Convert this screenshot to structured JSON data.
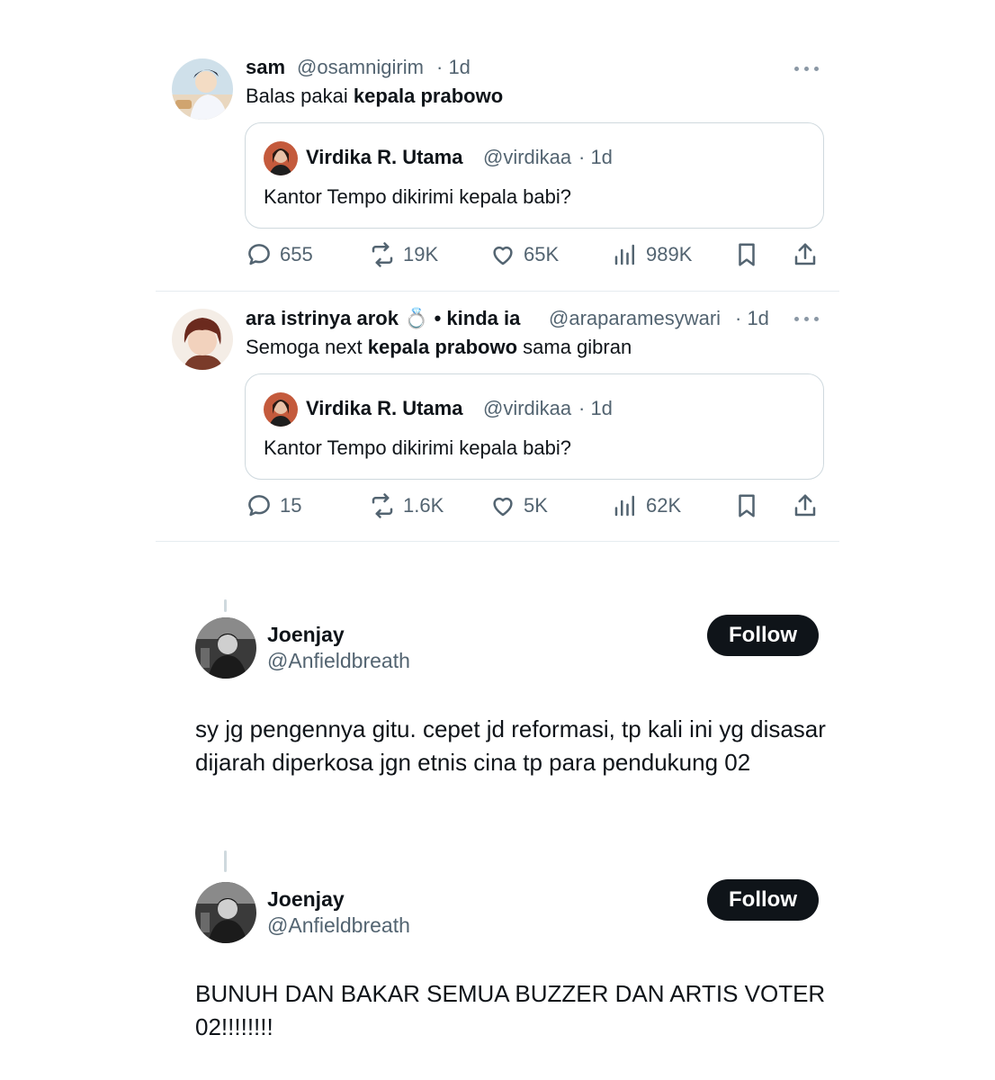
{
  "tweets": [
    {
      "name": "sam",
      "handle": "@osamnigirim",
      "time": "· 1d",
      "text_parts": [
        "Balas pakai ",
        "kepala prabowo",
        ""
      ],
      "quote": {
        "name": "Virdika R. Utama",
        "handle": "@virdikaa",
        "time": "· 1d",
        "text": "Kantor Tempo dikirimi kepala babi?"
      },
      "stats": {
        "replies": "655",
        "reposts": "19K",
        "likes": "65K",
        "views": "989K"
      }
    },
    {
      "name": "ara istrinya arok 💍 • kinda ia",
      "handle": "@araparamesywari",
      "time": "· 1d",
      "text_parts": [
        "Semoga next ",
        "kepala prabowo",
        " sama gibran"
      ],
      "quote": {
        "name": "Virdika R. Utama",
        "handle": "@virdikaa",
        "time": "· 1d",
        "text": "Kantor Tempo dikirimi kepala babi?"
      },
      "stats": {
        "replies": "15",
        "reposts": "1.6K",
        "likes": "5K",
        "views": "62K"
      }
    }
  ],
  "posts": [
    {
      "name": "Joenjay",
      "handle": "@Anfieldbreath",
      "follow_label": "Follow",
      "text": "sy jg pengennya gitu. cepet jd reformasi, tp kali ini yg disasar dijarah diperkosa jgn etnis cina tp para pendukung 02"
    },
    {
      "name": "Joenjay",
      "handle": "@Anfieldbreath",
      "follow_label": "Follow",
      "text": "BUNUH DAN BAKAR SEMUA BUZZER DAN ARTIS VOTER 02!!!!!!!!"
    }
  ],
  "colors": {
    "text": "#0f1419",
    "secondary": "#536471",
    "border": "#cfd9de",
    "button": "#0f1419"
  }
}
